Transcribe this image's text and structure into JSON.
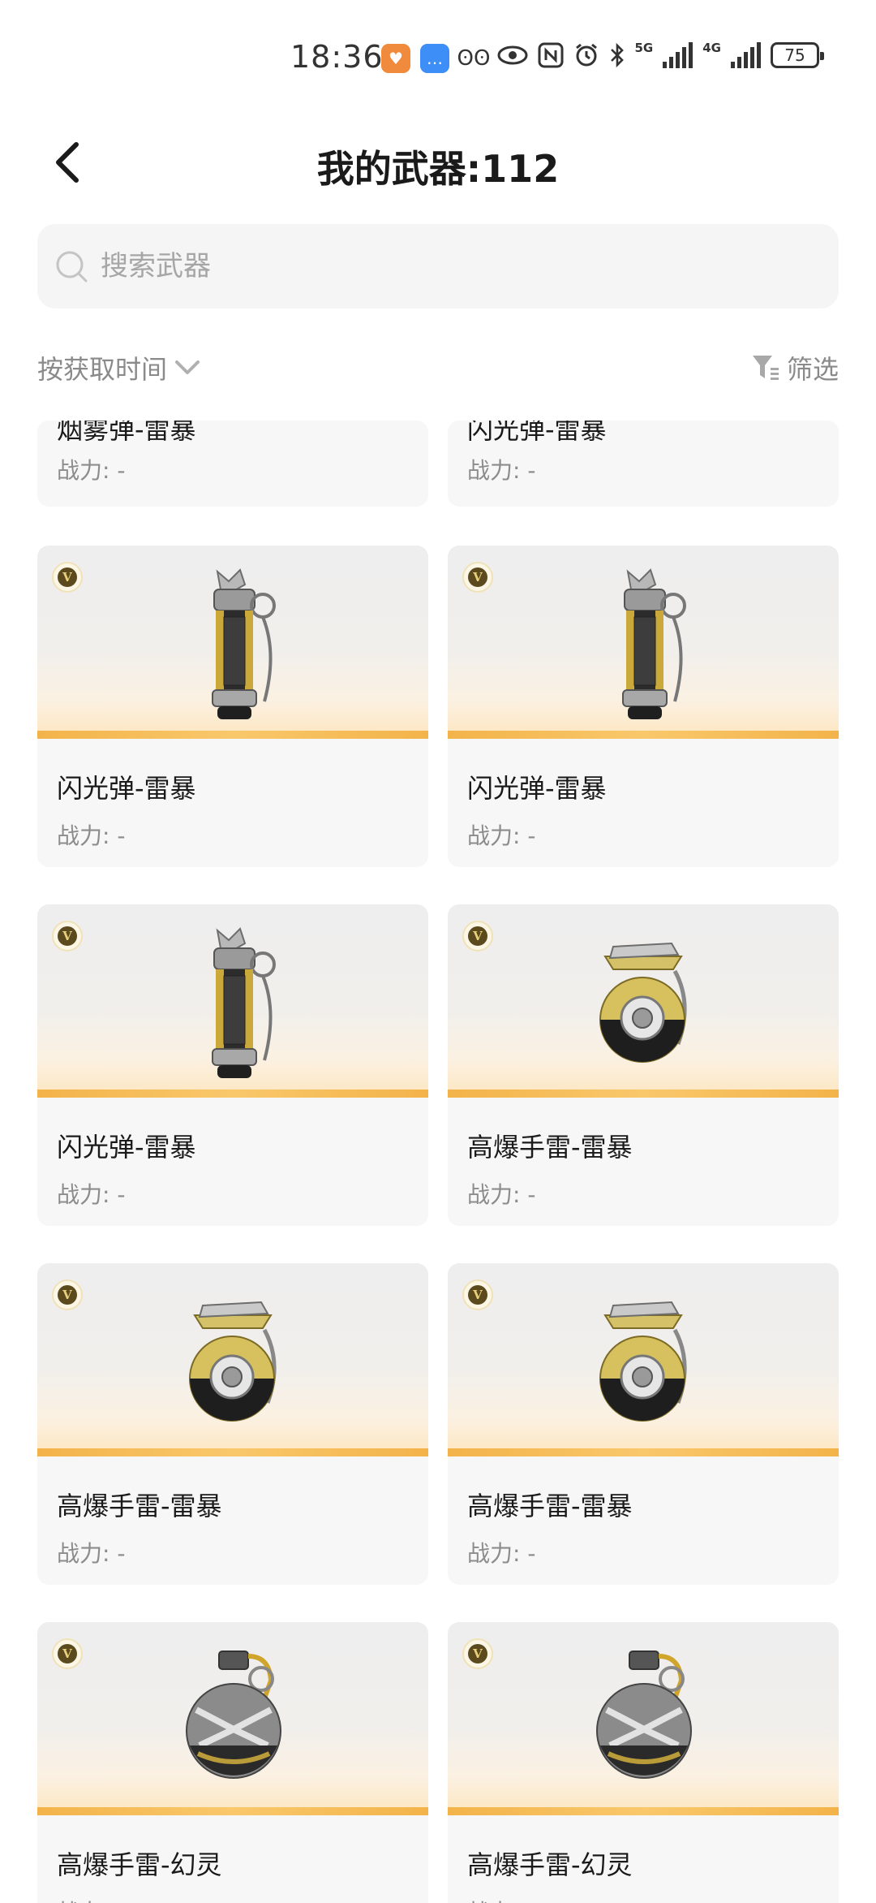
{
  "status_bar": {
    "time": "18:36",
    "net_5g": "5G",
    "net_4g": "4G",
    "battery": "75"
  },
  "header": {
    "title": "我的武器:112"
  },
  "search": {
    "placeholder": "搜索武器"
  },
  "toolbar": {
    "sort_label": "按获取时间",
    "filter_label": "筛选"
  },
  "power_label": "战力: -",
  "weapons": [
    {
      "name": "烟雾弹-雷暴",
      "type": "smoke"
    },
    {
      "name": "闪光弹-雷暴",
      "type": "flash"
    },
    {
      "name": "闪光弹-雷暴",
      "type": "flash"
    },
    {
      "name": "闪光弹-雷暴",
      "type": "flash"
    },
    {
      "name": "闪光弹-雷暴",
      "type": "flash"
    },
    {
      "name": "高爆手雷-雷暴",
      "type": "he-storm"
    },
    {
      "name": "高爆手雷-雷暴",
      "type": "he-storm"
    },
    {
      "name": "高爆手雷-雷暴",
      "type": "he-storm"
    },
    {
      "name": "高爆手雷-幻灵",
      "type": "he-phantom"
    },
    {
      "name": "高爆手雷-幻灵",
      "type": "he-phantom"
    }
  ],
  "badge_letter": "V",
  "colors": {
    "accent_stripe": "#f3b34a",
    "card_bg": "#f7f7f7",
    "muted_text": "#8c8c8c"
  }
}
